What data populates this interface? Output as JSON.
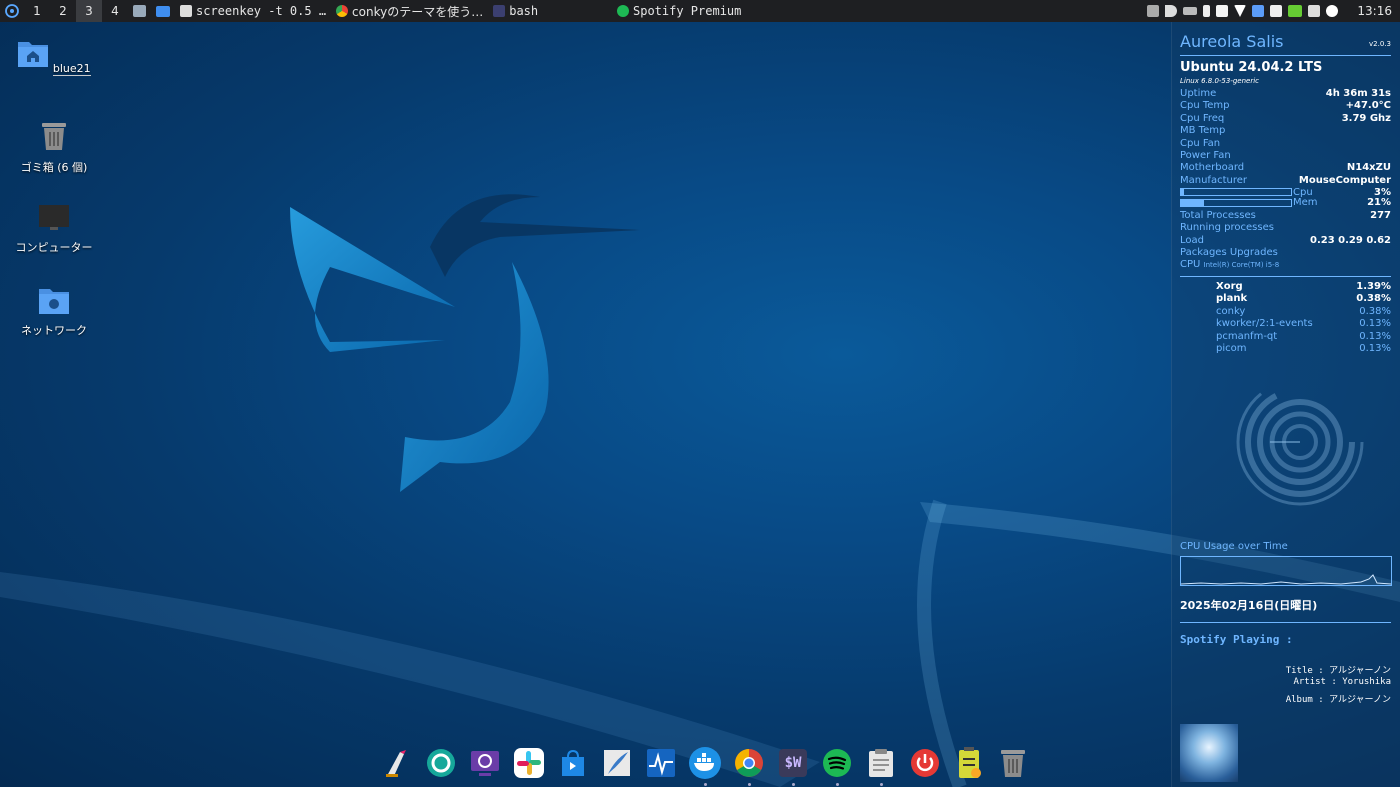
{
  "top_panel": {
    "workspaces": [
      "1",
      "2",
      "3",
      "4"
    ],
    "active_workspace": "3",
    "tasks": [
      {
        "label": "screenkey -t 0.5 …",
        "icon": "clipboard-icon"
      },
      {
        "label": "conkyのテーマを使う…",
        "icon": "chrome-icon"
      },
      {
        "label": "bash",
        "icon": "terminal-icon"
      }
    ],
    "center_title": "Spotify Premium",
    "clock": "13:16"
  },
  "desktop": {
    "icons": [
      {
        "label": "blue21",
        "icon": "home-folder-icon"
      },
      {
        "label": "ゴミ箱 (6 個)",
        "icon": "trash-icon"
      },
      {
        "label": "コンピューター",
        "icon": "computer-icon"
      },
      {
        "label": "ネットワーク",
        "icon": "network-folder-icon"
      }
    ]
  },
  "conky": {
    "title": "Aureola Salis",
    "version": "v2.0.3",
    "os": "Ubuntu 24.04.2 LTS",
    "kernel": "Linux 6.8.0-53-generic",
    "rows": [
      {
        "k": "Uptime",
        "v": "4h 36m 31s"
      },
      {
        "k": "Cpu Temp",
        "v": "+47.0°C"
      },
      {
        "k": "Cpu Freq",
        "v": "3.79 Ghz"
      },
      {
        "k": "MB Temp",
        "v": ""
      },
      {
        "k": "Cpu Fan",
        "v": ""
      },
      {
        "k": "Power Fan",
        "v": ""
      },
      {
        "k": "Motherboard",
        "v": "N14xZU"
      },
      {
        "k": "Manufacturer",
        "v": "MouseComputer"
      }
    ],
    "cpu_label": "Cpu",
    "cpu_value": "3%",
    "cpu_frac": 0.03,
    "mem_label": "Mem",
    "mem_value": "21%",
    "mem_frac": 0.21,
    "rows2": [
      {
        "k": "Total Processes",
        "v": "277"
      },
      {
        "k": "Running processes",
        "v": ""
      },
      {
        "k": "Load",
        "v": "0.23 0.29 0.62"
      },
      {
        "k": "Packages Upgrades",
        "v": ""
      }
    ],
    "cpu_model_label": "CPU",
    "cpu_model": "Intel(R) Core(TM) i5-8",
    "processes": [
      {
        "n": "Xorg",
        "v": "1.39%"
      },
      {
        "n": "plank",
        "v": "0.38%"
      },
      {
        "n": "conky",
        "v": "0.38%"
      },
      {
        "n": "kworker/2:1-events",
        "v": "0.13%"
      },
      {
        "n": "pcmanfm-qt",
        "v": "0.13%"
      },
      {
        "n": "picom",
        "v": "0.13%"
      }
    ],
    "graph_title": "CPU Usage over Time",
    "date": "2025年02月16日(日曜日)",
    "spotify_header": "Spotify Playing :",
    "spotify_title": "Title : アルジャーノン",
    "spotify_artist": "Artist : Yorushika",
    "spotify_album": "Album : アルジャーノン"
  },
  "dock": {
    "items": [
      {
        "icon": "text-editor-icon",
        "running": false
      },
      {
        "icon": "camera-shutter-icon",
        "running": false
      },
      {
        "icon": "remote-desktop-icon",
        "running": false
      },
      {
        "icon": "slack-icon",
        "running": false
      },
      {
        "icon": "software-store-icon",
        "running": false
      },
      {
        "icon": "feather-editor-icon",
        "running": false
      },
      {
        "icon": "system-monitor-icon",
        "running": false
      },
      {
        "icon": "docker-icon",
        "running": true
      },
      {
        "icon": "chrome-icon",
        "running": true
      },
      {
        "icon": "terminal-sw-icon",
        "running": true
      },
      {
        "icon": "spotify-icon",
        "running": true
      },
      {
        "icon": "clipboard-icon",
        "running": true
      },
      {
        "icon": "power-icon",
        "running": false
      },
      {
        "icon": "battery-doc-icon",
        "running": false
      },
      {
        "icon": "trash-icon",
        "running": false
      }
    ],
    "sw_label": "$W"
  },
  "colors": {
    "accent": "#6fb6ff",
    "panel": "#1e1f22",
    "spotify": "#1db954"
  }
}
